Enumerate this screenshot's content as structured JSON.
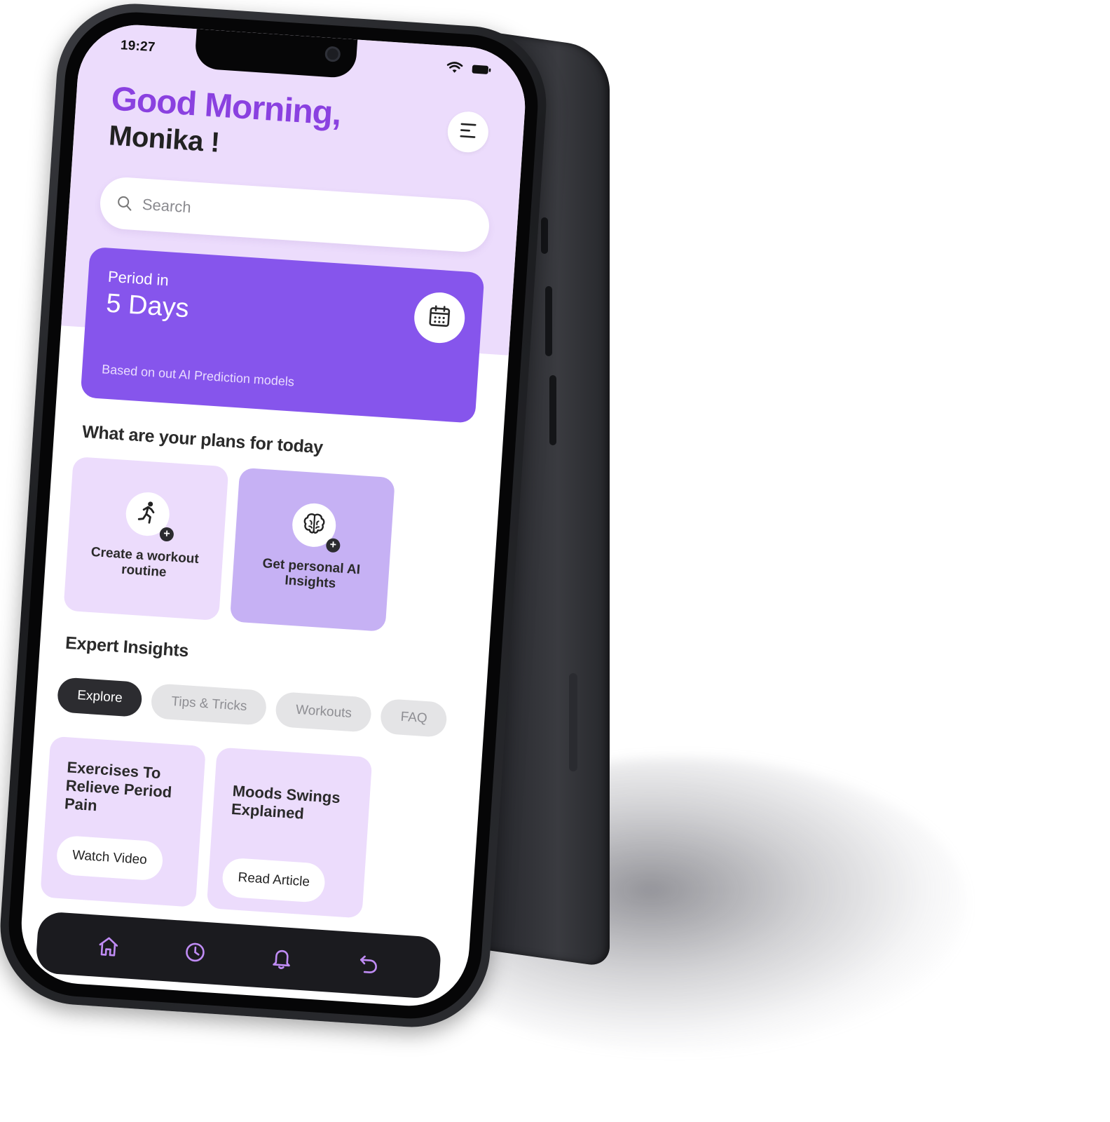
{
  "status_bar": {
    "time": "19:27",
    "icons": [
      "wifi-icon",
      "battery-icon"
    ]
  },
  "header": {
    "greeting": "Good Morning,",
    "name": "Monika !",
    "menu_icon": "menu-icon"
  },
  "search": {
    "placeholder": "Search",
    "icon": "search-icon"
  },
  "period_card": {
    "label": "Period in",
    "value": "5 Days",
    "note": "Based on out AI Prediction models",
    "icon": "calendar-icon"
  },
  "plans": {
    "title": "What are your plans for today",
    "cards": [
      {
        "label": "Create a workout routine",
        "icon": "running-person-icon"
      },
      {
        "label": "Get personal AI Insights",
        "icon": "brain-icon"
      }
    ]
  },
  "insights": {
    "title": "Expert Insights",
    "chips": [
      "Explore",
      "Tips & Tricks",
      "Workouts",
      "FAQ"
    ],
    "selected_chip": "Explore",
    "articles": [
      {
        "title": "Exercises To Relieve Period Pain",
        "action": "Watch Video"
      },
      {
        "title": "Moods Swings Explained",
        "action": "Read Article"
      }
    ]
  },
  "tab_bar": {
    "icons": [
      "home-icon",
      "clock-icon",
      "bell-icon",
      "back-icon"
    ]
  },
  "colors": {
    "accent_purple": "#8655ec",
    "greeting_purple": "#8a41e0",
    "light_lavender": "#ecdcfc",
    "medium_lavender": "#c6b1f4",
    "tab_icon": "#c08cf5",
    "dark": "#1b1b1f"
  }
}
